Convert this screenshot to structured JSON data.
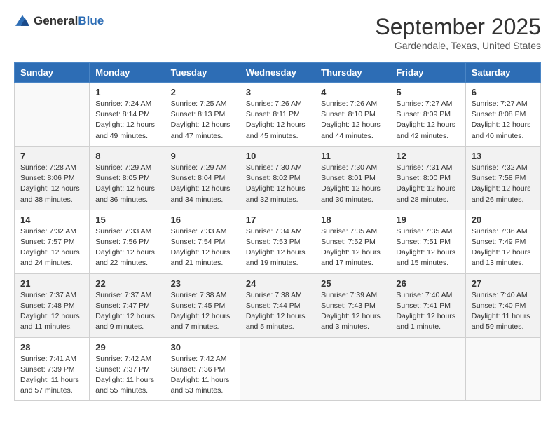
{
  "header": {
    "logo": {
      "general": "General",
      "blue": "Blue"
    },
    "title": "September 2025",
    "location": "Gardendale, Texas, United States"
  },
  "calendar": {
    "days_of_week": [
      "Sunday",
      "Monday",
      "Tuesday",
      "Wednesday",
      "Thursday",
      "Friday",
      "Saturday"
    ],
    "weeks": [
      {
        "days": [
          {
            "num": "",
            "info": ""
          },
          {
            "num": "1",
            "info": "Sunrise: 7:24 AM\nSunset: 8:14 PM\nDaylight: 12 hours\nand 49 minutes."
          },
          {
            "num": "2",
            "info": "Sunrise: 7:25 AM\nSunset: 8:13 PM\nDaylight: 12 hours\nand 47 minutes."
          },
          {
            "num": "3",
            "info": "Sunrise: 7:26 AM\nSunset: 8:11 PM\nDaylight: 12 hours\nand 45 minutes."
          },
          {
            "num": "4",
            "info": "Sunrise: 7:26 AM\nSunset: 8:10 PM\nDaylight: 12 hours\nand 44 minutes."
          },
          {
            "num": "5",
            "info": "Sunrise: 7:27 AM\nSunset: 8:09 PM\nDaylight: 12 hours\nand 42 minutes."
          },
          {
            "num": "6",
            "info": "Sunrise: 7:27 AM\nSunset: 8:08 PM\nDaylight: 12 hours\nand 40 minutes."
          }
        ]
      },
      {
        "days": [
          {
            "num": "7",
            "info": "Sunrise: 7:28 AM\nSunset: 8:06 PM\nDaylight: 12 hours\nand 38 minutes."
          },
          {
            "num": "8",
            "info": "Sunrise: 7:29 AM\nSunset: 8:05 PM\nDaylight: 12 hours\nand 36 minutes."
          },
          {
            "num": "9",
            "info": "Sunrise: 7:29 AM\nSunset: 8:04 PM\nDaylight: 12 hours\nand 34 minutes."
          },
          {
            "num": "10",
            "info": "Sunrise: 7:30 AM\nSunset: 8:02 PM\nDaylight: 12 hours\nand 32 minutes."
          },
          {
            "num": "11",
            "info": "Sunrise: 7:30 AM\nSunset: 8:01 PM\nDaylight: 12 hours\nand 30 minutes."
          },
          {
            "num": "12",
            "info": "Sunrise: 7:31 AM\nSunset: 8:00 PM\nDaylight: 12 hours\nand 28 minutes."
          },
          {
            "num": "13",
            "info": "Sunrise: 7:32 AM\nSunset: 7:58 PM\nDaylight: 12 hours\nand 26 minutes."
          }
        ]
      },
      {
        "days": [
          {
            "num": "14",
            "info": "Sunrise: 7:32 AM\nSunset: 7:57 PM\nDaylight: 12 hours\nand 24 minutes."
          },
          {
            "num": "15",
            "info": "Sunrise: 7:33 AM\nSunset: 7:56 PM\nDaylight: 12 hours\nand 22 minutes."
          },
          {
            "num": "16",
            "info": "Sunrise: 7:33 AM\nSunset: 7:54 PM\nDaylight: 12 hours\nand 21 minutes."
          },
          {
            "num": "17",
            "info": "Sunrise: 7:34 AM\nSunset: 7:53 PM\nDaylight: 12 hours\nand 19 minutes."
          },
          {
            "num": "18",
            "info": "Sunrise: 7:35 AM\nSunset: 7:52 PM\nDaylight: 12 hours\nand 17 minutes."
          },
          {
            "num": "19",
            "info": "Sunrise: 7:35 AM\nSunset: 7:51 PM\nDaylight: 12 hours\nand 15 minutes."
          },
          {
            "num": "20",
            "info": "Sunrise: 7:36 AM\nSunset: 7:49 PM\nDaylight: 12 hours\nand 13 minutes."
          }
        ]
      },
      {
        "days": [
          {
            "num": "21",
            "info": "Sunrise: 7:37 AM\nSunset: 7:48 PM\nDaylight: 12 hours\nand 11 minutes."
          },
          {
            "num": "22",
            "info": "Sunrise: 7:37 AM\nSunset: 7:47 PM\nDaylight: 12 hours\nand 9 minutes."
          },
          {
            "num": "23",
            "info": "Sunrise: 7:38 AM\nSunset: 7:45 PM\nDaylight: 12 hours\nand 7 minutes."
          },
          {
            "num": "24",
            "info": "Sunrise: 7:38 AM\nSunset: 7:44 PM\nDaylight: 12 hours\nand 5 minutes."
          },
          {
            "num": "25",
            "info": "Sunrise: 7:39 AM\nSunset: 7:43 PM\nDaylight: 12 hours\nand 3 minutes."
          },
          {
            "num": "26",
            "info": "Sunrise: 7:40 AM\nSunset: 7:41 PM\nDaylight: 12 hours\nand 1 minute."
          },
          {
            "num": "27",
            "info": "Sunrise: 7:40 AM\nSunset: 7:40 PM\nDaylight: 11 hours\nand 59 minutes."
          }
        ]
      },
      {
        "days": [
          {
            "num": "28",
            "info": "Sunrise: 7:41 AM\nSunset: 7:39 PM\nDaylight: 11 hours\nand 57 minutes."
          },
          {
            "num": "29",
            "info": "Sunrise: 7:42 AM\nSunset: 7:37 PM\nDaylight: 11 hours\nand 55 minutes."
          },
          {
            "num": "30",
            "info": "Sunrise: 7:42 AM\nSunset: 7:36 PM\nDaylight: 11 hours\nand 53 minutes."
          },
          {
            "num": "",
            "info": ""
          },
          {
            "num": "",
            "info": ""
          },
          {
            "num": "",
            "info": ""
          },
          {
            "num": "",
            "info": ""
          }
        ]
      }
    ]
  }
}
